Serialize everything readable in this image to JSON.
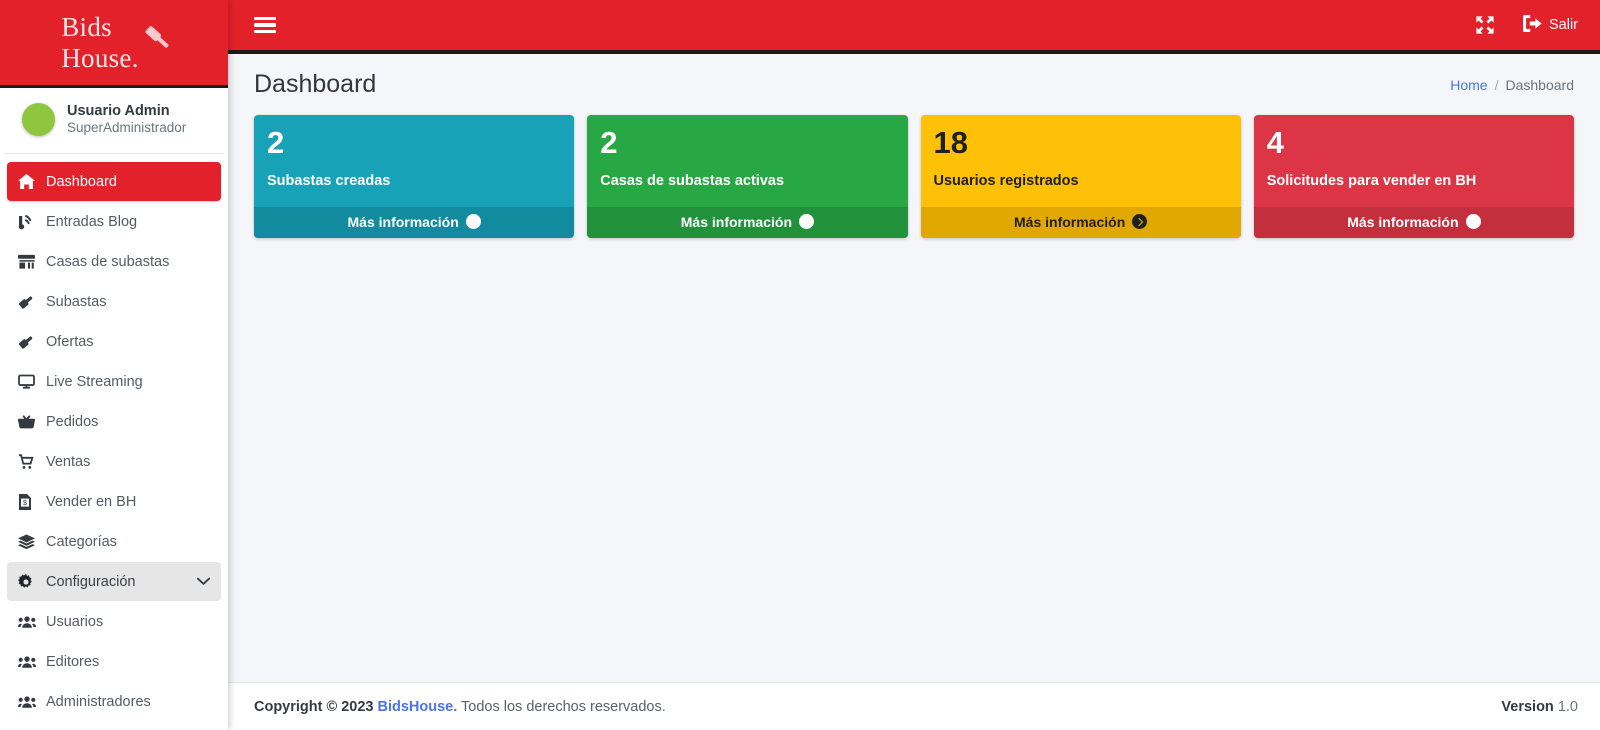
{
  "brand": {
    "line1": "Bids",
    "line2": "House.",
    "icon": "gavel-icon",
    "bg_color": "#e3212a"
  },
  "user": {
    "name": "Usuario Admin",
    "role": "SuperAdministrador",
    "avatar_color": "#8ec63f"
  },
  "sidebar": {
    "items": [
      {
        "label": "Dashboard",
        "icon": "home-icon",
        "state": "active"
      },
      {
        "label": "Entradas Blog",
        "icon": "blog-rss-icon",
        "state": "normal"
      },
      {
        "label": "Casas de subastas",
        "icon": "store-icon",
        "state": "normal"
      },
      {
        "label": "Subastas",
        "icon": "gavel-icon",
        "state": "normal"
      },
      {
        "label": "Ofertas",
        "icon": "gavel-icon",
        "state": "normal"
      },
      {
        "label": "Live Streaming",
        "icon": "desktop-icon",
        "state": "normal"
      },
      {
        "label": "Pedidos",
        "icon": "basket-icon",
        "state": "normal"
      },
      {
        "label": "Ventas",
        "icon": "cart-icon",
        "state": "normal"
      },
      {
        "label": "Vender en BH",
        "icon": "invoice-icon",
        "state": "normal"
      },
      {
        "label": "Categorías",
        "icon": "layers-icon",
        "state": "normal"
      },
      {
        "label": "Configuración",
        "icon": "gear-icon",
        "state": "open",
        "caret": "chevron-down-icon"
      },
      {
        "label": "Usuarios",
        "icon": "users-icon",
        "state": "normal"
      },
      {
        "label": "Editores",
        "icon": "users-icon",
        "state": "normal"
      },
      {
        "label": "Administradores",
        "icon": "users-icon",
        "state": "normal"
      }
    ]
  },
  "topbar": {
    "menu_toggle": "hamburger-icon",
    "fullscreen": "expand-arrows-icon",
    "logout_label": "Salir",
    "logout_icon": "sign-out-icon"
  },
  "header": {
    "title": "Dashboard",
    "breadcrumb": {
      "home": "Home",
      "separator": "/",
      "current": "Dashboard"
    }
  },
  "cards": [
    {
      "value": "2",
      "label": "Subastas creadas",
      "link": "Más información",
      "bg": "#17a2b8",
      "footer_bg": "#138b9e",
      "text": "light"
    },
    {
      "value": "2",
      "label": "Casas de subastas activas",
      "link": "Más información",
      "bg": "#28a745",
      "footer_bg": "#22913c",
      "text": "light"
    },
    {
      "value": "18",
      "label": "Usuarios registrados",
      "link": "Más información",
      "bg": "#ffc107",
      "footer_bg": "#e0a800",
      "text": "dark"
    },
    {
      "value": "4",
      "label": "Solicitudes para vender en BH",
      "link": "Más información",
      "bg": "#dc3545",
      "footer_bg": "#c32f3d",
      "text": "light"
    }
  ],
  "footer": {
    "copyright_prefix": "Copyright © 2023",
    "brand": "BidsHouse.",
    "rights": "Todos los derechos reservados.",
    "version_label": "Version",
    "version_number": "1.0"
  }
}
